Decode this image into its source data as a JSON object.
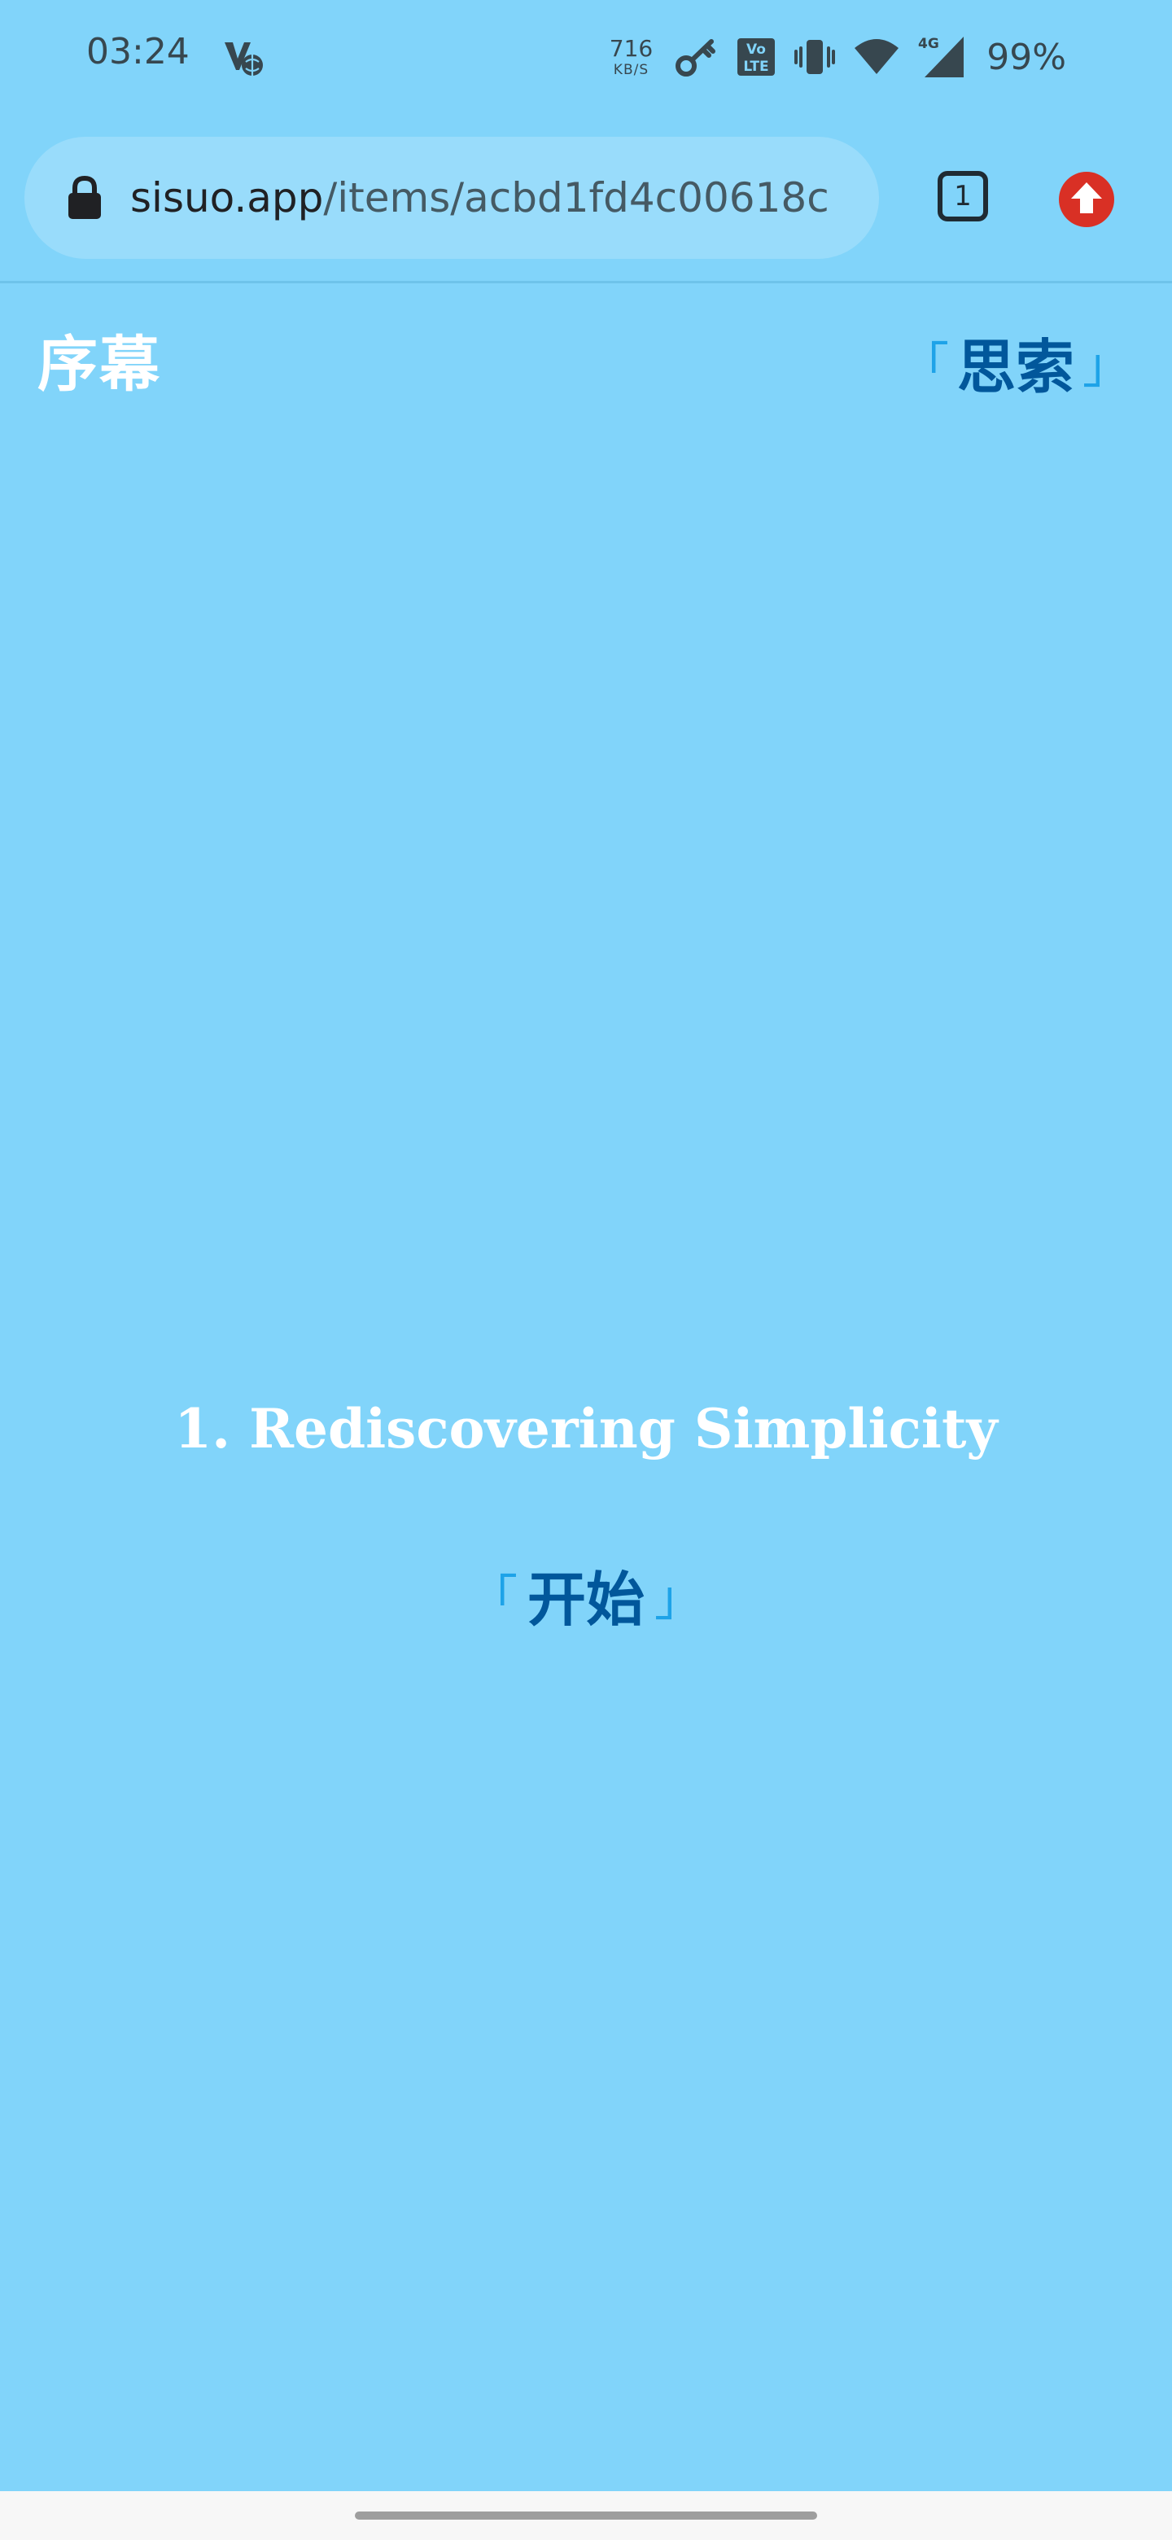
{
  "status_bar": {
    "time": "03:24",
    "network_speed_value": "716",
    "network_speed_unit": "KB/S",
    "network_type": "4G",
    "volte_label_top": "Vo",
    "volte_label_bottom": "LTE",
    "battery": "99%",
    "icons": [
      "vpn-globe-icon",
      "key-icon",
      "volte-icon",
      "vibrate-icon",
      "wifi-icon",
      "signal-icon"
    ]
  },
  "browser": {
    "url_domain": "sisuo.app",
    "url_path": "/items/acbd1fd4c00618c",
    "tab_count": "1",
    "icons": [
      "lock-icon",
      "tab-switcher-icon",
      "update-arrow-icon"
    ],
    "colors": {
      "update_badge": "#d93025"
    }
  },
  "page": {
    "header_title": "序幕",
    "header_link": {
      "open_bracket": "「",
      "label": "思索",
      "close_bracket": "」"
    },
    "chapter_title": "1. Rediscovering Simplicity",
    "start_link": {
      "open_bracket": "「",
      "label": "开始",
      "close_bracket": "」"
    },
    "colors": {
      "background": "#81d4fa",
      "link_text": "#01579b",
      "bracket": "#1ea3e8",
      "title_text": "#ffffff"
    }
  }
}
